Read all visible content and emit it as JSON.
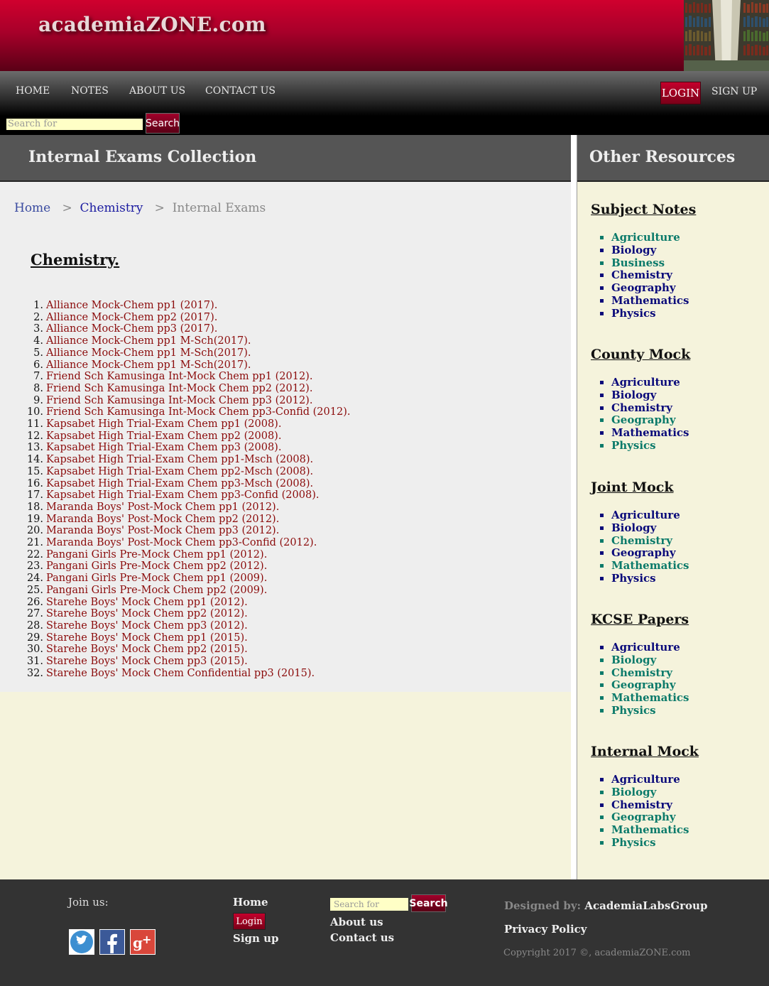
{
  "site": {
    "logo": "academiaZONE.com"
  },
  "nav": {
    "items": [
      "HOME",
      "NOTES",
      "ABOUT US",
      "CONTACT US"
    ],
    "login": "LOGIN",
    "signup": "SIGN UP",
    "search_placeholder": "Search for",
    "search_button": "Search"
  },
  "main": {
    "heading": "Internal Exams Collection",
    "breadcrumb": {
      "home": "Home",
      "sep": ">",
      "chemistry": "Chemistry",
      "current": "Internal Exams"
    },
    "section_title": "Chemistry.",
    "exams": [
      "Alliance Mock-Chem pp1 (2017).",
      "Alliance Mock-Chem pp2 (2017).",
      "Alliance Mock-Chem pp3 (2017).",
      "Alliance Mock-Chem pp1 M-Sch(2017).",
      "Alliance Mock-Chem pp1 M-Sch(2017).",
      "Alliance Mock-Chem pp1 M-Sch(2017).",
      "Friend Sch Kamusinga Int-Mock Chem pp1 (2012).",
      "Friend Sch Kamusinga Int-Mock Chem pp2 (2012).",
      "Friend Sch Kamusinga Int-Mock Chem pp3 (2012).",
      "Friend Sch Kamusinga Int-Mock Chem pp3-Confid (2012).",
      "Kapsabet High Trial-Exam Chem pp1 (2008).",
      "Kapsabet High Trial-Exam Chem pp2 (2008).",
      "Kapsabet High Trial-Exam Chem pp3 (2008).",
      "Kapsabet High Trial-Exam Chem pp1-Msch (2008).",
      "Kapsabet High Trial-Exam Chem pp2-Msch (2008).",
      "Kapsabet High Trial-Exam Chem pp3-Msch (2008).",
      "Kapsabet High Trial-Exam Chem pp3-Confid (2008).",
      "Maranda Boys' Post-Mock Chem pp1 (2012).",
      "Maranda Boys' Post-Mock Chem pp2 (2012).",
      "Maranda Boys' Post-Mock Chem pp3 (2012).",
      "Maranda Boys' Post-Mock Chem pp3-Confid (2012).",
      "Pangani Girls Pre-Mock Chem pp1 (2012).",
      "Pangani Girls Pre-Mock Chem pp2 (2012).",
      "Pangani Girls Pre-Mock Chem pp1 (2009).",
      "Pangani Girls Pre-Mock Chem pp2 (2009).",
      "Starehe Boys' Mock Chem pp1 (2012).",
      "Starehe Boys' Mock Chem pp2 (2012).",
      "Starehe Boys' Mock Chem pp3 (2012).",
      "Starehe Boys' Mock Chem pp1 (2015).",
      "Starehe Boys' Mock Chem pp2 (2015).",
      "Starehe Boys' Mock Chem pp3 (2015).",
      "Starehe Boys' Mock Chem Confidential pp3 (2015)."
    ]
  },
  "sidebar": {
    "heading": "Other Resources",
    "sections": [
      {
        "title": "Subject Notes",
        "items": [
          {
            "label": "Agriculture",
            "color": "teal"
          },
          {
            "label": "Biology",
            "color": "navy"
          },
          {
            "label": "Business",
            "color": "teal"
          },
          {
            "label": "Chemistry",
            "color": "navy"
          },
          {
            "label": "Geography",
            "color": "navy"
          },
          {
            "label": "Mathematics",
            "color": "navy"
          },
          {
            "label": "Physics",
            "color": "navy"
          }
        ]
      },
      {
        "title": "County Mock",
        "items": [
          {
            "label": "Agriculture",
            "color": "navy"
          },
          {
            "label": "Biology",
            "color": "navy"
          },
          {
            "label": "Chemistry",
            "color": "navy"
          },
          {
            "label": "Geography",
            "color": "teal"
          },
          {
            "label": "Mathematics",
            "color": "navy"
          },
          {
            "label": "Physics",
            "color": "teal"
          }
        ]
      },
      {
        "title": "Joint Mock",
        "items": [
          {
            "label": "Agriculture",
            "color": "navy"
          },
          {
            "label": "Biology",
            "color": "navy"
          },
          {
            "label": "Chemistry",
            "color": "teal"
          },
          {
            "label": "Geography",
            "color": "navy"
          },
          {
            "label": "Mathematics",
            "color": "teal"
          },
          {
            "label": "Physics",
            "color": "navy"
          }
        ]
      },
      {
        "title": "KCSE Papers",
        "items": [
          {
            "label": "Agriculture",
            "color": "navy"
          },
          {
            "label": "Biology",
            "color": "teal"
          },
          {
            "label": "Chemistry",
            "color": "teal"
          },
          {
            "label": "Geography",
            "color": "teal"
          },
          {
            "label": "Mathematics",
            "color": "teal"
          },
          {
            "label": "Physics",
            "color": "teal"
          }
        ]
      },
      {
        "title": "Internal Mock",
        "items": [
          {
            "label": "Agriculture",
            "color": "navy"
          },
          {
            "label": "Biology",
            "color": "teal"
          },
          {
            "label": "Chemistry",
            "color": "navy"
          },
          {
            "label": "Geography",
            "color": "teal"
          },
          {
            "label": "Mathematics",
            "color": "teal"
          },
          {
            "label": "Physics",
            "color": "teal"
          }
        ]
      }
    ]
  },
  "footer": {
    "join": "Join us:",
    "social_icons": [
      "twitter-icon",
      "facebook-icon",
      "google-plus-icon"
    ],
    "home": "Home",
    "login": "Login",
    "signup": "Sign up",
    "search_placeholder": "Search for",
    "search_button": "Search",
    "about": "About us",
    "contact": "Contact us",
    "designed_label": "Designed by:",
    "designed_by": "AcademiaLabsGroup",
    "privacy": "Privacy Policy",
    "copyright": "Copyright 2017 ©, academiaZONE.com"
  },
  "colors": {
    "brand_red": "#c4002c",
    "link_red": "#8b0b0b",
    "navy": "#0a0a7a",
    "teal": "#0b7a6a",
    "sidebar_bg": "#f5f3dc"
  }
}
